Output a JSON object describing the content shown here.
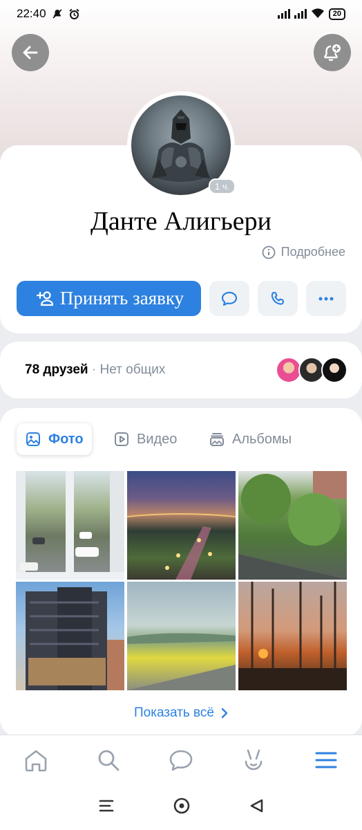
{
  "status_bar": {
    "time": "22:40",
    "battery": "20"
  },
  "profile": {
    "name": "Данте Алигьери",
    "avatar_badge": "1 ч.",
    "more_label": "Подробнее",
    "primary_action": "Принять заявку"
  },
  "friends": {
    "count_label": "78 друзей",
    "separator": "·",
    "common_label": "Нет общих"
  },
  "media": {
    "tabs": [
      {
        "label": "Фото",
        "icon": "image-icon",
        "active": true
      },
      {
        "label": "Видео",
        "icon": "play-icon",
        "active": false
      },
      {
        "label": "Альбомы",
        "icon": "albums-icon",
        "active": false
      }
    ],
    "photos": [
      "window-courtyard",
      "city-night-park",
      "tree-lined-street",
      "hotel-building",
      "yellow-field-road",
      "sunset-birches"
    ],
    "show_all": "Показать всё"
  },
  "bottom_nav": [
    "home-icon",
    "search-icon",
    "messages-icon",
    "clips-icon",
    "menu-icon"
  ],
  "colors": {
    "accent": "#2d81e0",
    "secondary_text": "#818c99",
    "background": "#ebedf0"
  }
}
